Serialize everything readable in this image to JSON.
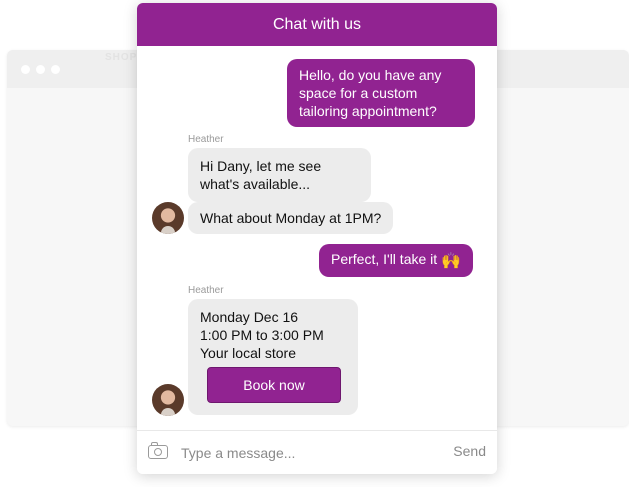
{
  "background_window": {
    "text": "SHOP"
  },
  "chat": {
    "header_title": "Chat with us",
    "messages": [
      {
        "direction": "outgoing",
        "text": "Hello, do you have any space for a custom tailoring appointment?"
      },
      {
        "direction": "incoming",
        "sender": "Heather",
        "text": "Hi Dany, let me see what's available..."
      },
      {
        "direction": "incoming",
        "text": "What about Monday at 1PM?"
      },
      {
        "direction": "outgoing",
        "text": "Perfect, I'll take it",
        "emoji": "🙌"
      },
      {
        "direction": "incoming",
        "sender": "Heather",
        "lines": [
          "Monday Dec 16",
          "1:00 PM to 3:00 PM",
          "Your local store"
        ],
        "button_label": "Book now"
      }
    ],
    "composer": {
      "placeholder": "Type a message...",
      "send_label": "Send"
    }
  },
  "colors": {
    "brand": "#912391",
    "incoming_bubble": "#ececec"
  }
}
